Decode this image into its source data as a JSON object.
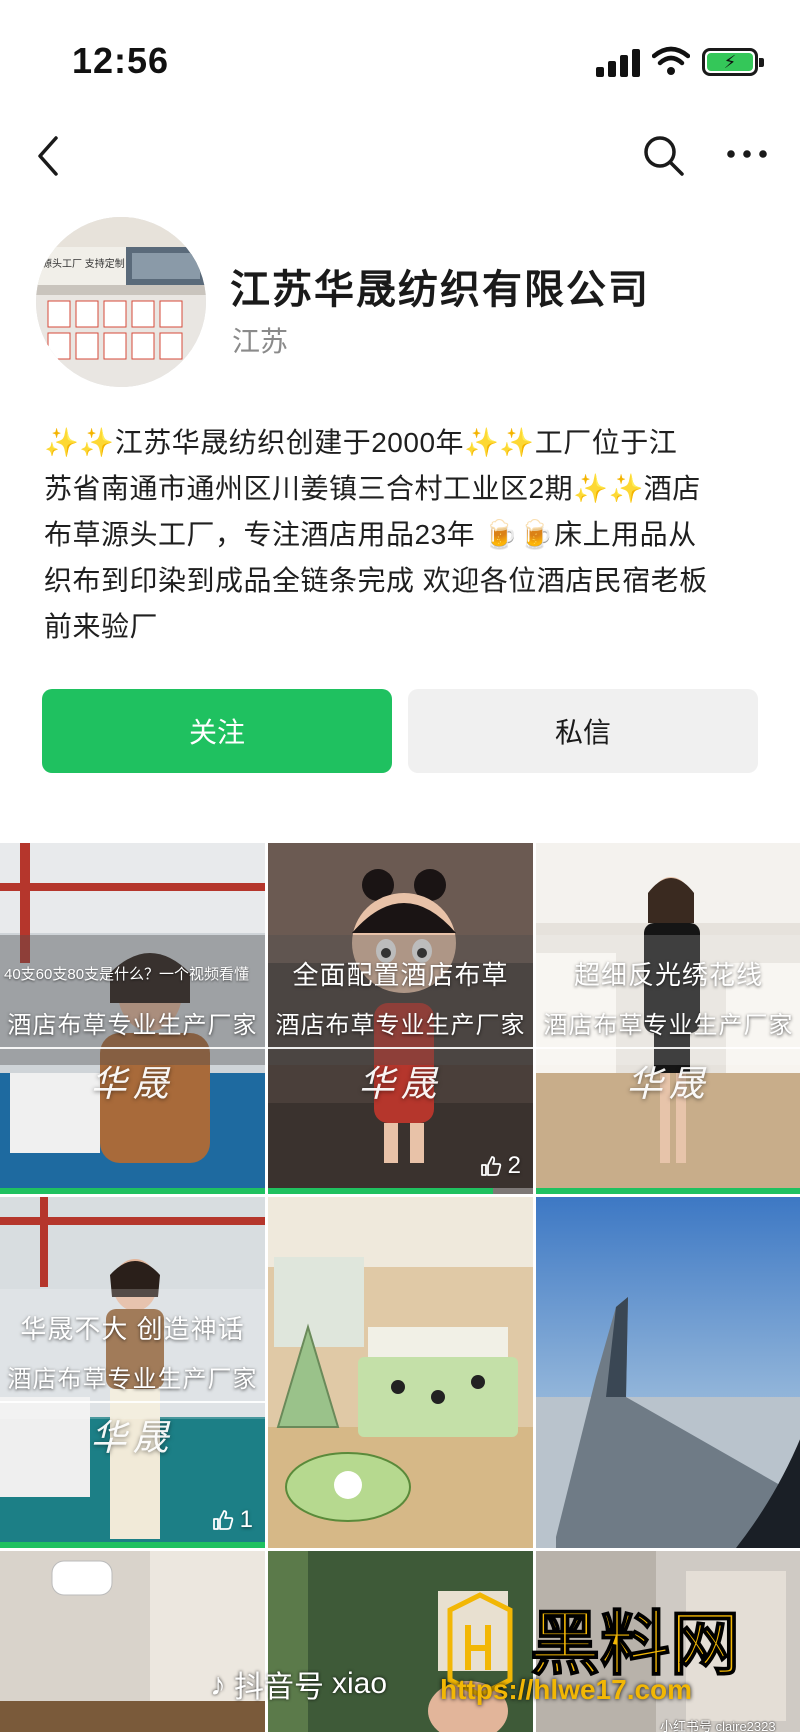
{
  "status": {
    "time": "12:56"
  },
  "profile": {
    "name": "江苏华晟纺织有限公司",
    "location": "江苏",
    "avatar_banner": "源头工厂 支持定制",
    "bio_lines": [
      "✨✨江苏华晟纺织创建于2000年✨✨工厂位于江",
      "苏省南通市通州区川姜镇三合村工业区2期✨✨酒店",
      "布草源头工厂，专注酒店用品23年 🍺🍺床上用品从",
      "织布到印染到成品全链条完成 欢迎各位酒店民宿老板",
      "前来验厂"
    ]
  },
  "actions": {
    "follow_label": "关注",
    "message_label": "私信"
  },
  "videos": [
    {
      "top_caption": "40支60支80支是什么？一个视频看懂",
      "sub_caption": "酒店布草专业生产厂家",
      "brand": "华晟",
      "progress": 1.0,
      "likes": ""
    },
    {
      "top_caption": "全面配置酒店布草",
      "sub_caption": "酒店布草专业生产厂家",
      "brand": "华晟",
      "progress": 0.85,
      "likes": "2"
    },
    {
      "top_caption": "超细反光绣花线",
      "sub_caption": "酒店布草专业生产厂家",
      "brand": "华晟",
      "progress": 1.0,
      "likes": ""
    },
    {
      "top_caption": "华晟不大 创造神话",
      "sub_caption": "酒店布草专业生产厂家",
      "brand": "华晟",
      "progress": 1.0,
      "likes": "1"
    },
    {
      "top_caption": "",
      "sub_caption": "",
      "brand": "",
      "progress": 0,
      "likes": ""
    },
    {
      "top_caption": "",
      "sub_caption": "",
      "brand": "",
      "progress": 0,
      "likes": ""
    }
  ],
  "watermark": {
    "douyin": "抖音号",
    "douyin_id": "xiao",
    "site_name": "黑料网",
    "site_url": "https://hlwe17.com",
    "xhs": "小红书号 claire2323"
  },
  "colors": {
    "accent": "#1fc160",
    "follow_bg": "#1fc160",
    "message_bg": "#f0f0f0"
  }
}
